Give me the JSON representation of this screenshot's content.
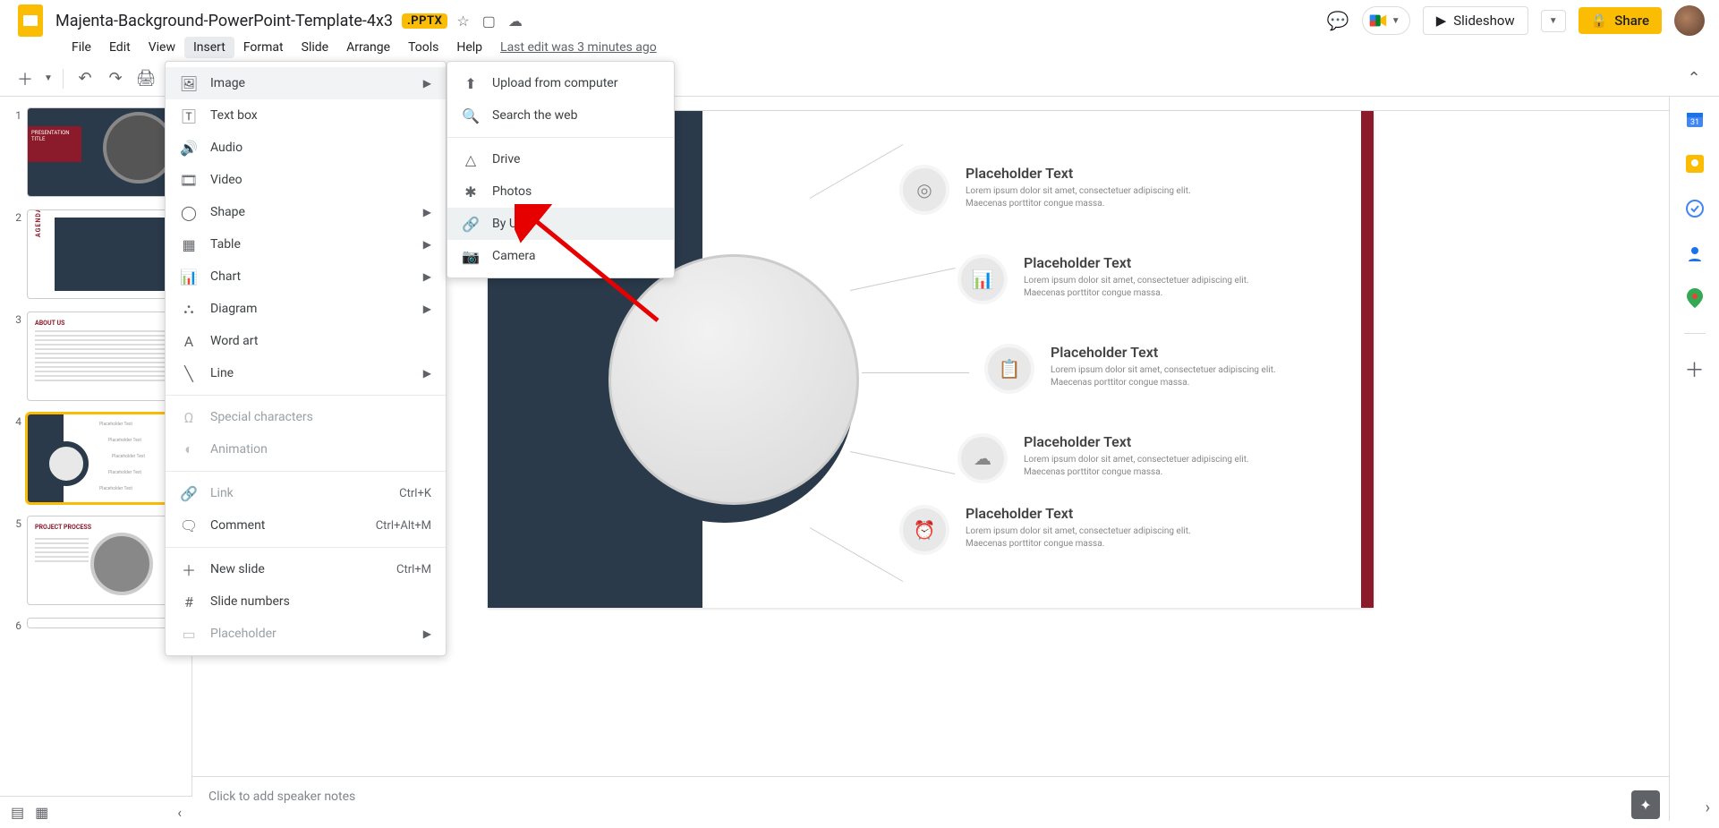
{
  "header": {
    "doc_title": "Majenta-Background-PowerPoint-Template-4x3",
    "badge": ".PPTX",
    "last_edit": "Last edit was 3 minutes ago",
    "slideshow_label": "Slideshow",
    "share_label": "Share"
  },
  "menubar": {
    "file": "File",
    "edit": "Edit",
    "view": "View",
    "insert": "Insert",
    "format": "Format",
    "slide": "Slide",
    "arrange": "Arrange",
    "tools": "Tools",
    "help": "Help"
  },
  "insert_menu": {
    "image": "Image",
    "text_box": "Text box",
    "audio": "Audio",
    "video": "Video",
    "shape": "Shape",
    "table": "Table",
    "chart": "Chart",
    "diagram": "Diagram",
    "word_art": "Word art",
    "line": "Line",
    "special_characters": "Special characters",
    "animation": "Animation",
    "link": "Link",
    "link_shortcut": "Ctrl+K",
    "comment": "Comment",
    "comment_shortcut": "Ctrl+Alt+M",
    "new_slide": "New slide",
    "new_slide_shortcut": "Ctrl+M",
    "slide_numbers": "Slide numbers",
    "placeholder": "Placeholder"
  },
  "image_submenu": {
    "upload": "Upload from computer",
    "search_web": "Search the web",
    "drive": "Drive",
    "photos": "Photos",
    "by_url": "By URL",
    "camera": "Camera"
  },
  "thumbs": {
    "t1_num": "1",
    "t1_title": "PRESENTATION TITLE",
    "t2_num": "2",
    "t2_agenda": "AGENDA",
    "t3_num": "3",
    "t3_title": "ABOUT US",
    "t4_num": "4",
    "t5_num": "5",
    "t5_title": "PROJECT PROCESS",
    "t6_num": "6"
  },
  "slide": {
    "items": [
      {
        "heading": "Placeholder Text",
        "body": "Lorem ipsum dolor sit amet, consectetuer adipiscing elit. Maecenas porttitor congue massa."
      },
      {
        "heading": "Placeholder Text",
        "body": "Lorem ipsum dolor sit amet, consectetuer adipiscing elit. Maecenas porttitor congue massa."
      },
      {
        "heading": "Placeholder Text",
        "body": "Lorem ipsum dolor sit amet, consectetuer adipiscing elit. Maecenas porttitor congue massa."
      },
      {
        "heading": "Placeholder Text",
        "body": "Lorem ipsum dolor sit amet, consectetuer adipiscing elit. Maecenas porttitor congue massa."
      },
      {
        "heading": "Placeholder Text",
        "body": "Lorem ipsum dolor sit amet, consectetuer adipiscing elit. Maecenas porttitor congue massa."
      }
    ]
  },
  "notes": {
    "placeholder": "Click to add speaker notes"
  }
}
